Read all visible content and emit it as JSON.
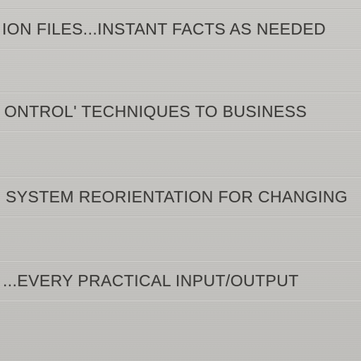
{
  "lines": [
    {
      "text": "ION FILES...INSTANT FACTS AS NEEDED"
    },
    {
      "text": "ONTROL' TECHNIQUES TO BUSINESS"
    },
    {
      "text": "SYSTEM REORIENTATION FOR CHANGING"
    },
    {
      "text": "...EVERY PRACTICAL INPUT/OUTPUT"
    }
  ]
}
